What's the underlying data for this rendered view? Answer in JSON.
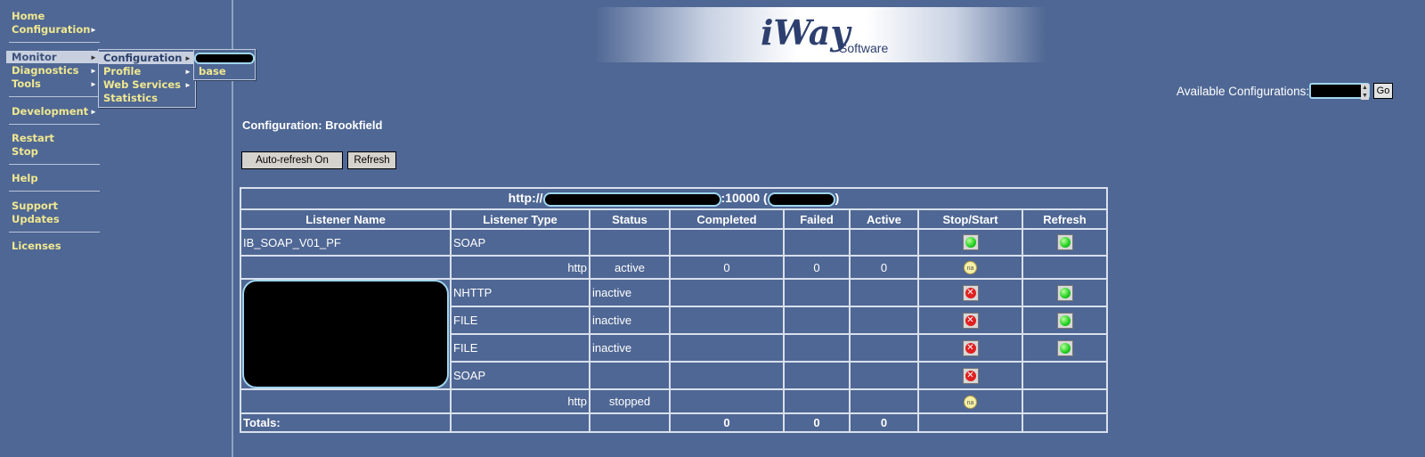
{
  "sidebar": {
    "items": [
      {
        "label": "Home",
        "submenu": false
      },
      {
        "label": "Configuration",
        "submenu": true
      },
      {
        "label": "Monitor",
        "submenu": true
      },
      {
        "label": "Diagnostics",
        "submenu": true
      },
      {
        "label": "Tools",
        "submenu": true
      },
      {
        "label": "Development",
        "submenu": true
      },
      {
        "label": "Restart",
        "submenu": false
      },
      {
        "label": "Stop",
        "submenu": false
      },
      {
        "label": "Help",
        "submenu": false
      },
      {
        "label": "Support",
        "submenu": false
      },
      {
        "label": "Updates",
        "submenu": false
      },
      {
        "label": "Licenses",
        "submenu": false
      }
    ],
    "active": "Monitor"
  },
  "monitor_menu": {
    "items": [
      "Configuration",
      "Profile",
      "Web Services",
      "Statistics"
    ]
  },
  "configuration_menu": {
    "items": [
      "[redacted]",
      "base"
    ]
  },
  "banner": {
    "logo_text": "iWay",
    "logo_sub": "Software"
  },
  "config_selector": {
    "label": "Available Configurations:",
    "selected": "[redacted]",
    "go_label": "Go"
  },
  "page_title": "Configuration: Brookfield",
  "buttons": {
    "auto_refresh": "Auto-refresh On",
    "refresh": "Refresh"
  },
  "table": {
    "caption_prefix": "http://",
    "caption_port": ":10000 (",
    "caption_suffix": ")",
    "headers": [
      "Listener Name",
      "Listener Type",
      "Status",
      "Completed",
      "Failed",
      "Active",
      "Stop/Start",
      "Refresh"
    ],
    "rows": [
      {
        "name": "IB_SOAP_V01_PF",
        "type": "SOAP",
        "status": "",
        "completed": "",
        "failed": "",
        "active": "",
        "stop_start": "green",
        "refresh": "green"
      },
      {
        "name": "",
        "type": "http",
        "status": "active",
        "completed": "0",
        "failed": "0",
        "active": "0",
        "stop_start": "na",
        "refresh": ""
      },
      {
        "name": "[redacted]",
        "type": "NHTTP",
        "status": "inactive",
        "completed": "",
        "failed": "",
        "active": "",
        "stop_start": "red",
        "refresh": "green"
      },
      {
        "name": "",
        "type": "FILE",
        "status": "inactive",
        "completed": "",
        "failed": "",
        "active": "",
        "stop_start": "red",
        "refresh": "green"
      },
      {
        "name": "",
        "type": "FILE",
        "status": "inactive",
        "completed": "",
        "failed": "",
        "active": "",
        "stop_start": "red",
        "refresh": "green"
      },
      {
        "name": "",
        "type": "SOAP",
        "status": "",
        "completed": "",
        "failed": "",
        "active": "",
        "stop_start": "red",
        "refresh": ""
      },
      {
        "name": "",
        "type": "http",
        "status": "stopped",
        "completed": "",
        "failed": "",
        "active": "",
        "stop_start": "na",
        "refresh": ""
      }
    ],
    "totals": {
      "label": "Totals:",
      "completed": "0",
      "failed": "0",
      "active": "0"
    },
    "na_text": "na",
    "x_text": "✕"
  },
  "colors": {
    "background": "#4f6794",
    "nav_text": "#f0e890",
    "redaction": "#000000",
    "redaction_border": "#9fd6ee"
  }
}
